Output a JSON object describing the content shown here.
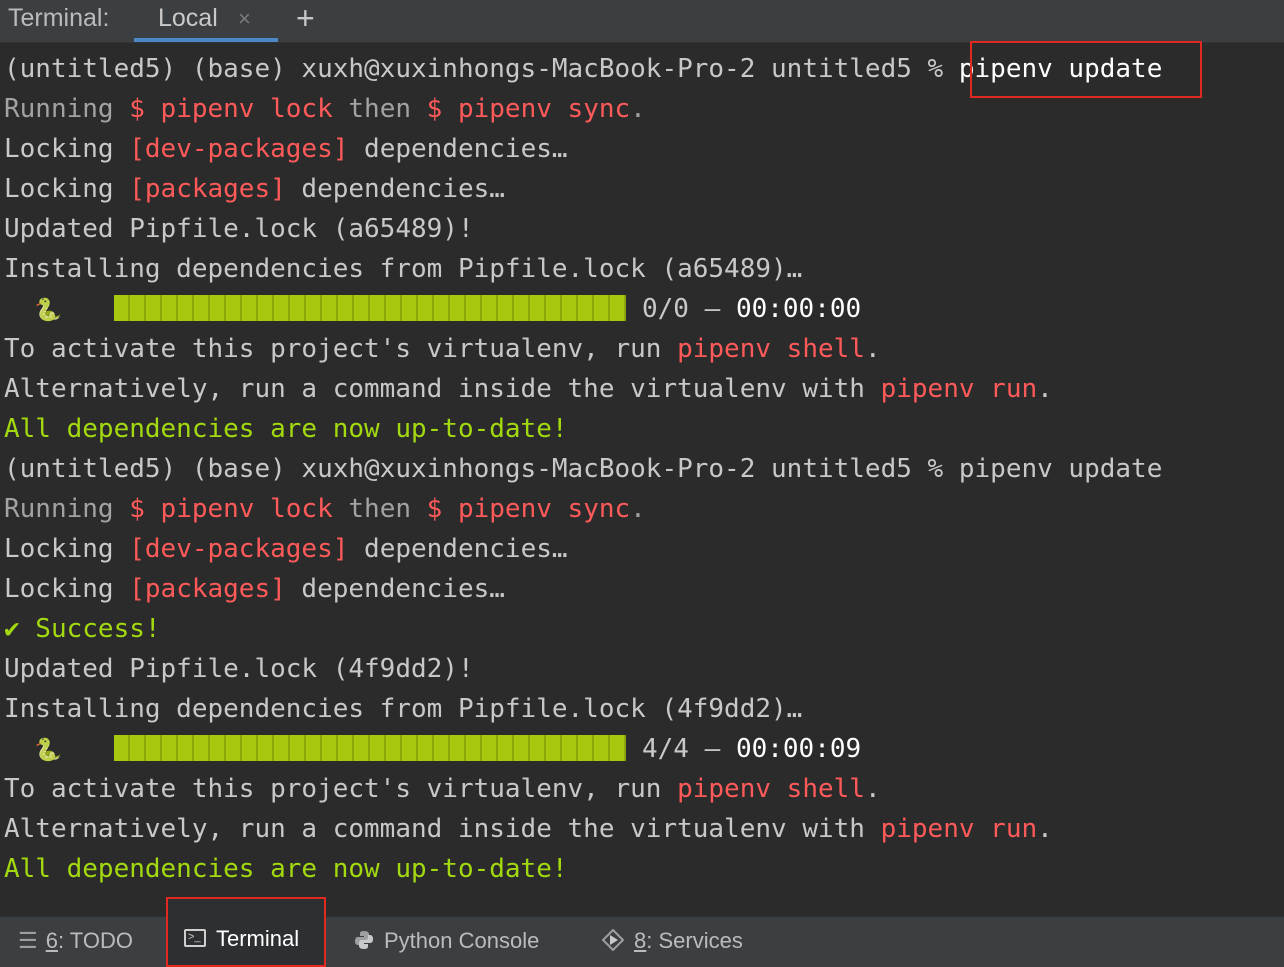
{
  "window": {
    "label": "Terminal:",
    "tab_name": "Local",
    "tab_close": "×",
    "new_tab": "+"
  },
  "terminal": {
    "prompt": "(untitled5) (base) xuxh@xuxinhongs-MacBook-Pro-2 untitled5 % ",
    "command": "pipenv update",
    "running_prefix": "Running ",
    "cmd_lock": "$ pipenv lock",
    "then": " then ",
    "cmd_sync": "$ pipenv sync",
    "period": ".",
    "locking": "Locking ",
    "dev_packages": "[dev-packages]",
    "packages": "[packages]",
    "dependencies": " dependencies…",
    "run1": {
      "updated": "Updated Pipfile.lock (a65489)!",
      "installing": "Installing dependencies from Pipfile.lock (a65489)…",
      "progress_count": "0/0",
      "progress_sep": " — ",
      "progress_time": "00:00:00",
      "progress_fraction": 1.0
    },
    "run2": {
      "success": "✔ Success!",
      "updated": "Updated Pipfile.lock (4f9dd2)!",
      "installing": "Installing dependencies from Pipfile.lock (4f9dd2)…",
      "progress_count": "4/4",
      "progress_sep": " — ",
      "progress_time": "00:00:09",
      "progress_fraction": 1.0
    },
    "activate_pre": "To activate this project's virtualenv, run ",
    "activate_cmd": "pipenv shell",
    "alt_pre": "Alternatively, run a command inside the virtualenv with ",
    "alt_cmd": "pipenv run",
    "all_ok": "All dependencies are now up-to-date!",
    "snake_glyph": "🐍"
  },
  "bottom": {
    "todo_num": "6",
    "todo_label": ": TODO",
    "terminal_label": "Terminal",
    "python_console_label": "Python Console",
    "services_num": "8",
    "services_label": ": Services"
  },
  "colors": {
    "background": "#2b2b2b",
    "red_text": "#ff5a5a",
    "green_text": "#a3d90f",
    "highlight_box": "#e0291f",
    "tab_underline": "#4a88c7"
  },
  "icons": [
    "list-icon",
    "terminal-icon",
    "python-icon",
    "services-icon",
    "close-icon",
    "plus-icon",
    "snake-icon"
  ]
}
